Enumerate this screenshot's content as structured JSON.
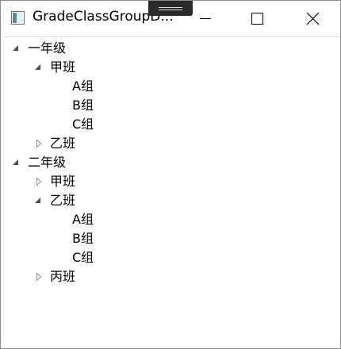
{
  "window": {
    "title": "GradeClassGroupD..."
  },
  "tree": {
    "grade1": {
      "label": "一年级",
      "class_jia": {
        "label": "甲班",
        "groups": [
          "A组",
          "B组",
          "C组"
        ]
      },
      "class_yi": {
        "label": "乙班"
      }
    },
    "grade2": {
      "label": "二年级",
      "class_jia": {
        "label": "甲班"
      },
      "class_yi": {
        "label": "乙班",
        "groups": [
          "A组",
          "B组",
          "C组"
        ]
      },
      "class_bing": {
        "label": "丙班"
      }
    }
  },
  "icons": {
    "expanded": "triangle-down-right-icon",
    "collapsed": "triangle-right-outline-icon"
  }
}
